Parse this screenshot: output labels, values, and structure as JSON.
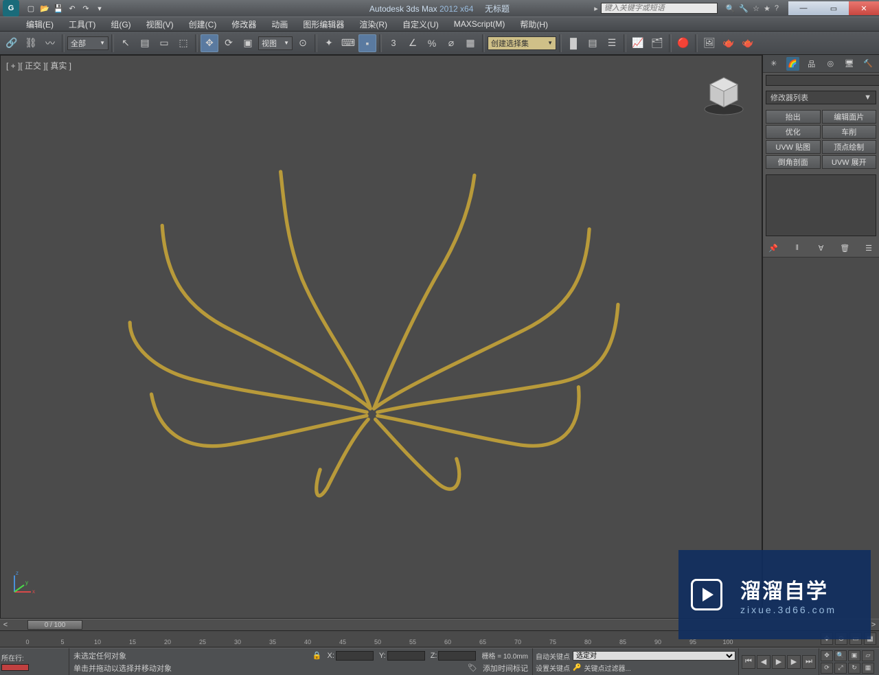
{
  "titlebar": {
    "app": "Autodesk 3ds Max ",
    "version": "2012 x64",
    "doc": "无标题",
    "search_placeholder": "键入关键字或短语"
  },
  "menu": [
    "编辑(E)",
    "工具(T)",
    "组(G)",
    "视图(V)",
    "创建(C)",
    "修改器",
    "动画",
    "图形编辑器",
    "渲染(R)",
    "自定义(U)",
    "MAXScript(M)",
    "帮助(H)"
  ],
  "toolbar": {
    "filter": "全部",
    "viewsel": "视图",
    "selset": "创建选择集"
  },
  "viewport": {
    "label": "[ + ][ 正交 ][ 真实 ]"
  },
  "rpanel": {
    "modlist": "修改器列表",
    "buttons": [
      "抬出",
      "编辑面片",
      "优化",
      "车削",
      "UVW 贴图",
      "顶点绘制",
      "倒角剖面",
      "UVW 展开"
    ]
  },
  "timeslider": {
    "pos": "0 / 100"
  },
  "ruler": {
    "ticks": [
      "0",
      "5",
      "10",
      "15",
      "20",
      "25",
      "30",
      "35",
      "40",
      "45",
      "50",
      "55",
      "60",
      "65",
      "70",
      "75",
      "80",
      "85",
      "90",
      "95",
      "100"
    ]
  },
  "status": {
    "prompt1": "未选定任何对象",
    "prompt2": "单击并拖动以选择并移动对象",
    "loc_label": "所在行:",
    "x": "X:",
    "y": "Y:",
    "z": "Z:",
    "grid": "栅格 = 10.0mm",
    "addtime": "添加时间标记",
    "autokey": "自动关键点",
    "setkey": "设置关键点",
    "selobj": "选定对",
    "keyfilter": "关键点过滤器..."
  },
  "watermark": {
    "big": "溜溜自学",
    "small": "zixue.3d66.com"
  }
}
